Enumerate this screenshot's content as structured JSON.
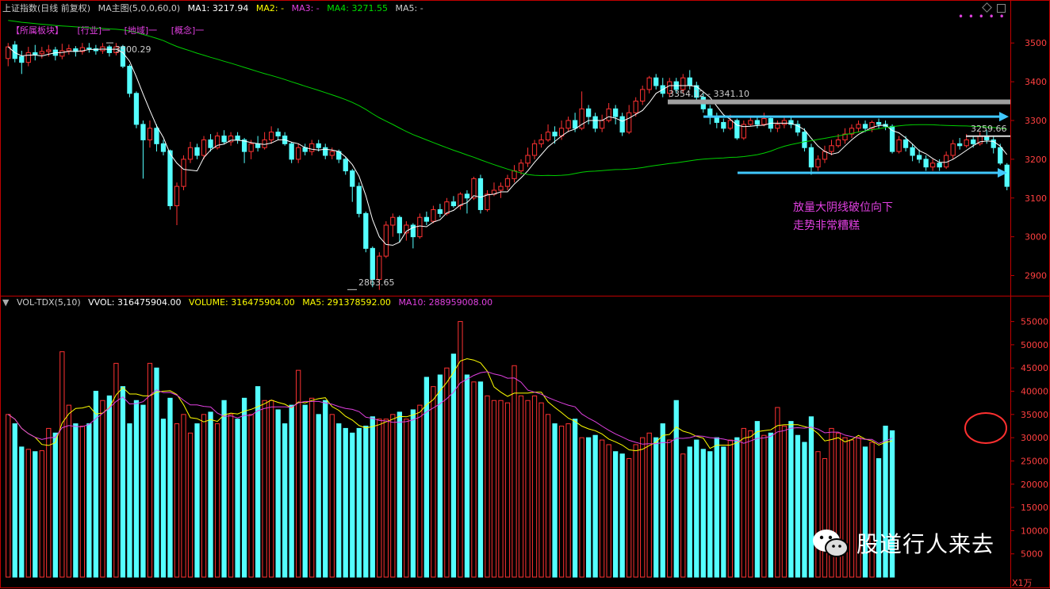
{
  "header": {
    "title": "上证指数(日线 前复权)",
    "indicator": "MA主图(5,0,0,60,0)",
    "ma1": "MA1: 3217.94",
    "ma2": "MA2: -",
    "ma3": "MA3: -",
    "ma4": "MA4: 3271.55",
    "ma5": "MA5: -"
  },
  "sections": [
    "【所属板块】",
    "[行业]一",
    "[地域]一",
    "[概念]一"
  ],
  "volume_header": {
    "name": "VOL-TDX(5,10)",
    "vvol": "VVOL: 316475904.00",
    "volume": "VOLUME: 316475904.00",
    "ma5": "MA5: 291378592.00",
    "ma10": "MA10: 288959008.00"
  },
  "annotations": {
    "high": "3500.29",
    "low": "2863.65",
    "range": "3354.12 - 3341.10",
    "level": "3259.66",
    "comment_line1": "放量大阴线破位向下",
    "comment_line2": "走势非常糟糕"
  },
  "watermark": "股道行人来去",
  "unit_label": "X1万",
  "colors": {
    "up": "#ff3232",
    "down": "#54ffff",
    "ma_short": "#ffffff",
    "ma_long": "#00d000",
    "vol_ma5": "#ffff00",
    "vol_ma10": "#e040e0",
    "support_line": "#40c8ff",
    "resistance_band": "#a0a0a0",
    "highlight_circle": "#ff3030",
    "axis": "#c00000",
    "label": "#ff4040",
    "magenta": "#e040e0",
    "yellow": "#ffff00",
    "green": "#00e000"
  },
  "chart_data": [
    {
      "type": "candlestick",
      "title": "上证指数(日线 前复权)",
      "y_ticks": [
        2900,
        3000,
        3100,
        3200,
        3300,
        3400,
        3500
      ],
      "ylim": [
        2850,
        3570
      ],
      "grid": false,
      "series": [
        {
          "name": "MA1",
          "kind": "line",
          "role": "short"
        },
        {
          "name": "MA4",
          "kind": "line",
          "role": "long"
        }
      ],
      "candles": [
        [
          3460,
          3490,
          3500,
          3440
        ],
        [
          3495,
          3460,
          3505,
          3450
        ],
        [
          3465,
          3450,
          3480,
          3420
        ],
        [
          3450,
          3475,
          3490,
          3440
        ],
        [
          3475,
          3470,
          3495,
          3455
        ],
        [
          3472,
          3478,
          3490,
          3460
        ],
        [
          3478,
          3482,
          3495,
          3465
        ],
        [
          3482,
          3468,
          3490,
          3455
        ],
        [
          3466,
          3480,
          3498,
          3458
        ],
        [
          3480,
          3485,
          3496,
          3470
        ],
        [
          3485,
          3478,
          3492,
          3465
        ],
        [
          3478,
          3488,
          3500,
          3470
        ],
        [
          3487,
          3485,
          3500,
          3475
        ],
        [
          3485,
          3480,
          3495,
          3470
        ],
        [
          3480,
          3490,
          3500,
          3472
        ],
        [
          3490,
          3475,
          3495,
          3465
        ],
        [
          3475,
          3490,
          3500,
          3468
        ],
        [
          3490,
          3440,
          3495,
          3435
        ],
        [
          3440,
          3370,
          3445,
          3360
        ],
        [
          3370,
          3290,
          3375,
          3280
        ],
        [
          3290,
          3250,
          3300,
          3150
        ],
        [
          3250,
          3280,
          3300,
          3230
        ],
        [
          3280,
          3240,
          3290,
          3220
        ],
        [
          3240,
          3220,
          3250,
          3210
        ],
        [
          3222,
          3080,
          3225,
          3070
        ],
        [
          3080,
          3130,
          3140,
          3030
        ],
        [
          3130,
          3200,
          3210,
          3120
        ],
        [
          3200,
          3230,
          3245,
          3190
        ],
        [
          3230,
          3210,
          3240,
          3200
        ],
        [
          3210,
          3250,
          3260,
          3200
        ],
        [
          3250,
          3230,
          3265,
          3220
        ],
        [
          3230,
          3260,
          3270,
          3225
        ],
        [
          3260,
          3245,
          3275,
          3240
        ],
        [
          3245,
          3260,
          3270,
          3235
        ],
        [
          3260,
          3250,
          3270,
          3240
        ],
        [
          3250,
          3220,
          3255,
          3190
        ],
        [
          3220,
          3240,
          3250,
          3200
        ],
        [
          3240,
          3230,
          3260,
          3220
        ],
        [
          3230,
          3250,
          3270,
          3225
        ],
        [
          3250,
          3270,
          3285,
          3240
        ],
        [
          3270,
          3260,
          3280,
          3250
        ],
        [
          3260,
          3240,
          3270,
          3235
        ],
        [
          3240,
          3200,
          3245,
          3190
        ],
        [
          3200,
          3230,
          3240,
          3190
        ],
        [
          3230,
          3220,
          3240,
          3210
        ],
        [
          3220,
          3240,
          3250,
          3210
        ],
        [
          3240,
          3230,
          3250,
          3220
        ],
        [
          3230,
          3210,
          3240,
          3200
        ],
        [
          3210,
          3220,
          3230,
          3200
        ],
        [
          3220,
          3200,
          3225,
          3190
        ],
        [
          3200,
          3170,
          3205,
          3160
        ],
        [
          3170,
          3130,
          3175,
          3090
        ],
        [
          3130,
          3060,
          3140,
          3050
        ],
        [
          3060,
          2970,
          3065,
          2960
        ],
        [
          2970,
          2890,
          2975,
          2870
        ],
        [
          2890,
          2950,
          2960,
          2863
        ],
        [
          2950,
          3030,
          3040,
          2945
        ],
        [
          3030,
          3050,
          3060,
          3000
        ],
        [
          3050,
          3010,
          3055,
          2985
        ],
        [
          3010,
          3030,
          3040,
          2990
        ],
        [
          3030,
          3000,
          3035,
          2970
        ],
        [
          3000,
          3050,
          3060,
          2995
        ],
        [
          3050,
          3040,
          3065,
          3030
        ],
        [
          3040,
          3070,
          3080,
          3035
        ],
        [
          3070,
          3060,
          3085,
          3050
        ],
        [
          3060,
          3090,
          3100,
          3055
        ],
        [
          3090,
          3080,
          3105,
          3075
        ],
        [
          3080,
          3110,
          3115,
          3070
        ],
        [
          3110,
          3100,
          3120,
          3060
        ],
        [
          3100,
          3150,
          3155,
          3095
        ],
        [
          3150,
          3070,
          3160,
          3060
        ],
        [
          3070,
          3110,
          3120,
          3065
        ],
        [
          3110,
          3120,
          3140,
          3105
        ],
        [
          3120,
          3130,
          3140,
          3100
        ],
        [
          3130,
          3150,
          3160,
          3120
        ],
        [
          3150,
          3170,
          3185,
          3140
        ],
        [
          3170,
          3190,
          3200,
          3160
        ],
        [
          3190,
          3210,
          3230,
          3180
        ],
        [
          3210,
          3240,
          3250,
          3200
        ],
        [
          3240,
          3250,
          3265,
          3230
        ],
        [
          3250,
          3270,
          3290,
          3245
        ],
        [
          3270,
          3260,
          3285,
          3240
        ],
        [
          3260,
          3280,
          3300,
          3250
        ],
        [
          3280,
          3300,
          3310,
          3270
        ],
        [
          3300,
          3280,
          3320,
          3270
        ],
        [
          3280,
          3330,
          3375,
          3275
        ],
        [
          3330,
          3310,
          3340,
          3290
        ],
        [
          3310,
          3280,
          3320,
          3270
        ],
        [
          3280,
          3300,
          3315,
          3270
        ],
        [
          3300,
          3330,
          3345,
          3295
        ],
        [
          3330,
          3310,
          3340,
          3290
        ],
        [
          3310,
          3270,
          3320,
          3260
        ],
        [
          3270,
          3320,
          3340,
          3265
        ],
        [
          3320,
          3350,
          3360,
          3310
        ],
        [
          3350,
          3380,
          3390,
          3340
        ],
        [
          3380,
          3410,
          3415,
          3370
        ],
        [
          3410,
          3390,
          3420,
          3380
        ],
        [
          3390,
          3370,
          3410,
          3360
        ],
        [
          3370,
          3400,
          3410,
          3360
        ],
        [
          3400,
          3380,
          3410,
          3370
        ],
        [
          3380,
          3410,
          3420,
          3370
        ],
        [
          3410,
          3390,
          3430,
          3380
        ],
        [
          3390,
          3360,
          3400,
          3350
        ],
        [
          3360,
          3330,
          3370,
          3320
        ],
        [
          3330,
          3310,
          3340,
          3290
        ],
        [
          3310,
          3295,
          3320,
          3280
        ],
        [
          3295,
          3280,
          3305,
          3270
        ],
        [
          3280,
          3300,
          3315,
          3275
        ],
        [
          3300,
          3255,
          3305,
          3250
        ],
        [
          3255,
          3290,
          3300,
          3250
        ],
        [
          3290,
          3300,
          3310,
          3285
        ],
        [
          3300,
          3290,
          3310,
          3280
        ],
        [
          3290,
          3305,
          3320,
          3285
        ],
        [
          3305,
          3280,
          3310,
          3270
        ],
        [
          3280,
          3290,
          3300,
          3270
        ],
        [
          3290,
          3300,
          3310,
          3280
        ],
        [
          3300,
          3290,
          3310,
          3280
        ],
        [
          3290,
          3270,
          3300,
          3260
        ],
        [
          3270,
          3230,
          3280,
          3220
        ],
        [
          3230,
          3180,
          3240,
          3160
        ],
        [
          3180,
          3200,
          3210,
          3170
        ],
        [
          3200,
          3220,
          3235,
          3190
        ],
        [
          3220,
          3235,
          3250,
          3210
        ],
        [
          3235,
          3250,
          3265,
          3230
        ],
        [
          3250,
          3265,
          3280,
          3240
        ],
        [
          3265,
          3280,
          3290,
          3255
        ],
        [
          3280,
          3290,
          3300,
          3270
        ],
        [
          3290,
          3280,
          3300,
          3270
        ],
        [
          3280,
          3295,
          3300,
          3270
        ],
        [
          3295,
          3290,
          3305,
          3280
        ],
        [
          3290,
          3285,
          3300,
          3275
        ],
        [
          3285,
          3220,
          3290,
          3215
        ],
        [
          3220,
          3250,
          3260,
          3215
        ],
        [
          3250,
          3230,
          3260,
          3220
        ],
        [
          3230,
          3210,
          3240,
          3195
        ],
        [
          3210,
          3200,
          3225,
          3190
        ],
        [
          3200,
          3180,
          3210,
          3170
        ],
        [
          3180,
          3190,
          3200,
          3170
        ],
        [
          3190,
          3180,
          3200,
          3170
        ],
        [
          3180,
          3210,
          3220,
          3175
        ],
        [
          3210,
          3240,
          3250,
          3200
        ],
        [
          3240,
          3235,
          3255,
          3225
        ],
        [
          3235,
          3250,
          3265,
          3230
        ],
        [
          3250,
          3240,
          3260,
          3230
        ],
        [
          3240,
          3260,
          3270,
          3235
        ],
        [
          3260,
          3250,
          3275,
          3240
        ],
        [
          3250,
          3230,
          3260,
          3215
        ],
        [
          3230,
          3190,
          3240,
          3185
        ],
        [
          3185,
          3130,
          3190,
          3120
        ]
      ]
    },
    {
      "type": "bar",
      "title": "VOL-TDX(5,10)",
      "unit": "X1万",
      "y_ticks": [
        5000,
        10000,
        15000,
        20000,
        25000,
        30000,
        35000,
        40000,
        45000,
        50000,
        55000
      ],
      "ylim": [
        0,
        58000
      ],
      "series": [
        {
          "name": "MA5",
          "kind": "line"
        },
        {
          "name": "MA10",
          "kind": "line"
        }
      ],
      "volumes": [
        35000,
        33000,
        28000,
        27500,
        27000,
        27200,
        32000,
        31000,
        48500,
        37000,
        33000,
        32500,
        33000,
        40000,
        38000,
        39000,
        46000,
        41000,
        33000,
        38000,
        37000,
        46000,
        45000,
        34000,
        38500,
        33000,
        35000,
        31000,
        33000,
        35000,
        35500,
        33000,
        38000,
        35000,
        34000,
        38500,
        35000,
        41000,
        38000,
        38000,
        36000,
        33000,
        37000,
        44500,
        37000,
        38500,
        35000,
        38000,
        35000,
        33000,
        32000,
        31000,
        32000,
        32500,
        34500,
        34000,
        34000,
        35000,
        35500,
        34000,
        36000,
        37000,
        43000,
        41000,
        43500,
        45000,
        48000,
        55000,
        43500,
        42000,
        42000,
        39000,
        38000,
        38000,
        37500,
        45500,
        39000,
        38000,
        39000,
        37500,
        35000,
        33000,
        32500,
        33000,
        34000,
        30000,
        30000,
        30500,
        29500,
        28500,
        27000,
        26500,
        25500,
        28500,
        30000,
        31000,
        30000,
        33000,
        29500,
        38000,
        26500,
        28000,
        29500,
        27500,
        27000,
        30000,
        28000,
        29500,
        30000,
        32000,
        31500,
        33500,
        30500,
        31000,
        36500,
        32500,
        33500,
        30500,
        29000,
        34500,
        27000,
        25500,
        32000,
        31000,
        30000,
        29500,
        30000,
        28000,
        29000,
        25500,
        32500,
        31500
      ]
    }
  ]
}
